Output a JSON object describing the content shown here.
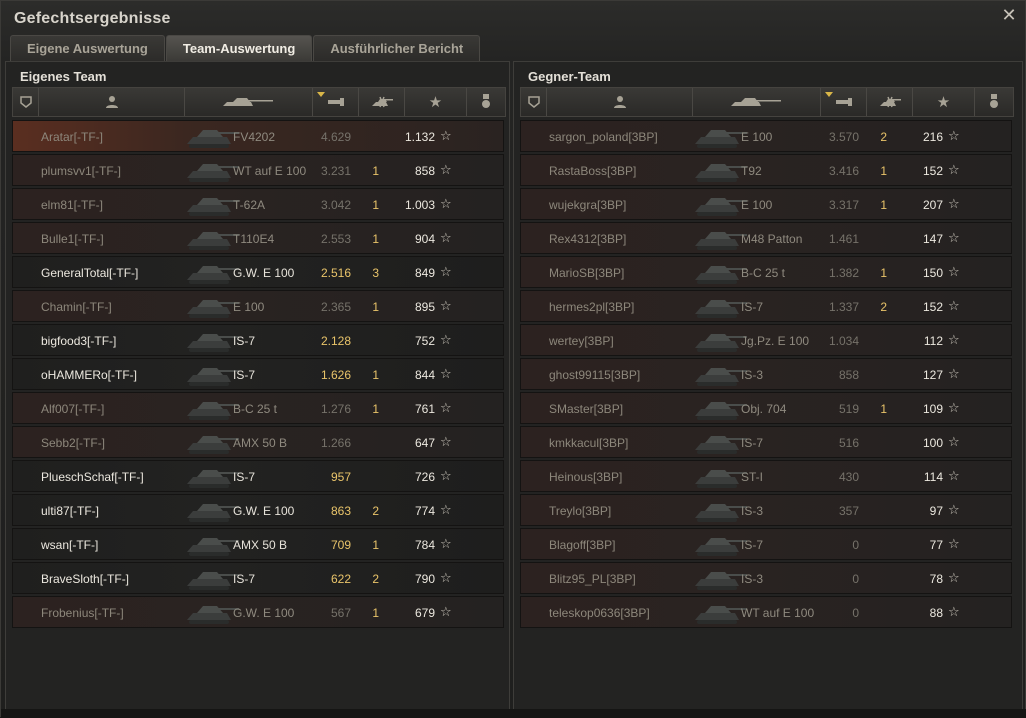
{
  "window": {
    "title": "Gefechtsergebnisse"
  },
  "tabs": [
    {
      "label": "Eigene Auswertung",
      "active": false
    },
    {
      "label": "Team-Auswertung",
      "active": true
    },
    {
      "label": "Ausführlicher Bericht",
      "active": false
    }
  ],
  "own_team": {
    "title": "Eigenes Team",
    "header_icons": [
      "platoon-icon",
      "player-icon",
      "tank-icon",
      "damage-icon",
      "kills-icon",
      "xp-star-icon",
      "medal-icon"
    ],
    "rows": [
      {
        "name": "Aratar[-TF-]",
        "tank": "FV4202",
        "damage": "4.629",
        "kills": "",
        "xp": "1.132",
        "alive": false,
        "self": true
      },
      {
        "name": "plumsvv1[-TF-]",
        "tank": "WT auf E 100",
        "damage": "3.231",
        "kills": "1",
        "xp": "858",
        "alive": false,
        "self": false
      },
      {
        "name": "elm81[-TF-]",
        "tank": "T-62A",
        "damage": "3.042",
        "kills": "1",
        "xp": "1.003",
        "alive": false,
        "self": false
      },
      {
        "name": "Bulle1[-TF-]",
        "tank": "T110E4",
        "damage": "2.553",
        "kills": "1",
        "xp": "904",
        "alive": false,
        "self": false
      },
      {
        "name": "GeneralTotal[-TF-]",
        "tank": "G.W. E 100",
        "damage": "2.516",
        "kills": "3",
        "xp": "849",
        "alive": true,
        "self": false
      },
      {
        "name": "Chamin[-TF-]",
        "tank": "E 100",
        "damage": "2.365",
        "kills": "1",
        "xp": "895",
        "alive": false,
        "self": false
      },
      {
        "name": "bigfood3[-TF-]",
        "tank": "IS-7",
        "damage": "2.128",
        "kills": "",
        "xp": "752",
        "alive": true,
        "self": false
      },
      {
        "name": "oHAMMERo[-TF-]",
        "tank": "IS-7",
        "damage": "1.626",
        "kills": "1",
        "xp": "844",
        "alive": true,
        "self": false
      },
      {
        "name": "Alf007[-TF-]",
        "tank": "B-C 25 t",
        "damage": "1.276",
        "kills": "1",
        "xp": "761",
        "alive": false,
        "self": false
      },
      {
        "name": "Sebb2[-TF-]",
        "tank": "AMX 50 B",
        "damage": "1.266",
        "kills": "",
        "xp": "647",
        "alive": false,
        "self": false
      },
      {
        "name": "PlueschSchaf[-TF-]",
        "tank": "IS-7",
        "damage": "957",
        "kills": "",
        "xp": "726",
        "alive": true,
        "self": false
      },
      {
        "name": "ulti87[-TF-]",
        "tank": "G.W. E 100",
        "damage": "863",
        "kills": "2",
        "xp": "774",
        "alive": true,
        "self": false
      },
      {
        "name": "wsan[-TF-]",
        "tank": "AMX 50 B",
        "damage": "709",
        "kills": "1",
        "xp": "784",
        "alive": true,
        "self": false
      },
      {
        "name": "BraveSloth[-TF-]",
        "tank": "IS-7",
        "damage": "622",
        "kills": "2",
        "xp": "790",
        "alive": true,
        "self": false
      },
      {
        "name": "Frobenius[-TF-]",
        "tank": "G.W. E 100",
        "damage": "567",
        "kills": "1",
        "xp": "679",
        "alive": false,
        "self": false
      }
    ]
  },
  "enemy_team": {
    "title": "Gegner-Team",
    "header_icons": [
      "platoon-icon",
      "player-icon",
      "tank-icon",
      "damage-icon",
      "kills-icon",
      "xp-star-icon",
      "medal-icon"
    ],
    "rows": [
      {
        "name": "sargon_poland[3BP]",
        "tank": "E 100",
        "damage": "3.570",
        "kills": "2",
        "xp": "216",
        "alive": false
      },
      {
        "name": "RastaBoss[3BP]",
        "tank": "T92",
        "damage": "3.416",
        "kills": "1",
        "xp": "152",
        "alive": false
      },
      {
        "name": "wujekgra[3BP]",
        "tank": "E 100",
        "damage": "3.317",
        "kills": "1",
        "xp": "207",
        "alive": false
      },
      {
        "name": "Rex4312[3BP]",
        "tank": "M48 Patton",
        "damage": "1.461",
        "kills": "",
        "xp": "147",
        "alive": false
      },
      {
        "name": "MarioSB[3BP]",
        "tank": "B-C 25 t",
        "damage": "1.382",
        "kills": "1",
        "xp": "150",
        "alive": false
      },
      {
        "name": "hermes2pl[3BP]",
        "tank": "IS-7",
        "damage": "1.337",
        "kills": "2",
        "xp": "152",
        "alive": false
      },
      {
        "name": "wertey[3BP]",
        "tank": "Jg.Pz. E 100",
        "damage": "1.034",
        "kills": "",
        "xp": "112",
        "alive": false
      },
      {
        "name": "ghost99115[3BP]",
        "tank": "IS-3",
        "damage": "858",
        "kills": "",
        "xp": "127",
        "alive": false
      },
      {
        "name": "SMaster[3BP]",
        "tank": "Obj. 704",
        "damage": "519",
        "kills": "1",
        "xp": "109",
        "alive": false
      },
      {
        "name": "kmkkacul[3BP]",
        "tank": "IS-7",
        "damage": "516",
        "kills": "",
        "xp": "100",
        "alive": false
      },
      {
        "name": "Heinous[3BP]",
        "tank": "ST-I",
        "damage": "430",
        "kills": "",
        "xp": "114",
        "alive": false
      },
      {
        "name": "Treylo[3BP]",
        "tank": "IS-3",
        "damage": "357",
        "kills": "",
        "xp": "97",
        "alive": false
      },
      {
        "name": "Blagoff[3BP]",
        "tank": "IS-7",
        "damage": "0",
        "kills": "",
        "xp": "77",
        "alive": false
      },
      {
        "name": "Blitz95_PL[3BP]",
        "tank": "IS-3",
        "damage": "0",
        "kills": "",
        "xp": "78",
        "alive": false
      },
      {
        "name": "teleskop0636[3BP]",
        "tank": "WT auf E 100",
        "damage": "0",
        "kills": "",
        "xp": "88",
        "alive": false
      }
    ]
  },
  "colors": {
    "accent_gold": "#e9c46a",
    "dead_text": "#8d877b",
    "alive_text": "#ece8df",
    "self_row": "#5a2e20"
  }
}
